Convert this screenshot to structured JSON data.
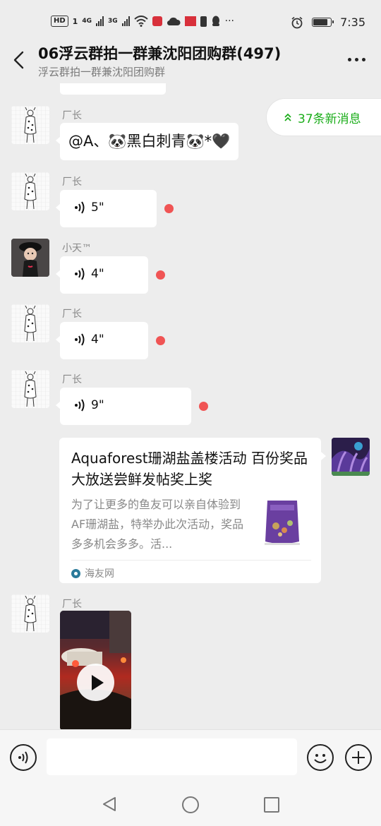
{
  "status_bar": {
    "left_badges": [
      "HD",
      "1",
      "4G",
      "3G"
    ],
    "time": "7:35"
  },
  "header": {
    "title": "06浮云群拍一群兼沈阳团购群(497)",
    "subtitle": "浮云群拍一群兼沈阳团购群"
  },
  "new_messages": {
    "label": "37条新消息"
  },
  "messages": [
    {
      "sender": "厂长",
      "type": "text",
      "text": "@A、🐼黑白刺青🐼*🖤"
    },
    {
      "sender": "厂长",
      "type": "voice",
      "duration": "5\""
    },
    {
      "sender": "小天™",
      "type": "voice",
      "duration": "4\""
    },
    {
      "sender": "厂长",
      "type": "voice",
      "duration": "4\""
    },
    {
      "sender": "厂长",
      "type": "voice",
      "duration": "9\""
    }
  ],
  "link_card": {
    "title": "Aquaforest珊湖盐盖楼活动 百份奖品大放送尝鲜发帖奖上奖",
    "description": "为了让更多的鱼友可以亲自体验到AF珊湖盐，特举办此次活动，奖品多多机会多多。活...",
    "source": "海友网"
  },
  "video_message": {
    "sender": "厂长"
  },
  "colors": {
    "accent_green": "#1aad19",
    "unread_dot": "#f05454",
    "chat_background": "#ededed"
  },
  "icons": [
    "back-arrow-icon",
    "more-icon",
    "double-chevron-up-icon",
    "voice-wave-icon",
    "play-icon",
    "voice-mode-icon",
    "emoji-icon",
    "plus-icon",
    "nav-back-icon",
    "nav-home-icon",
    "nav-recent-icon"
  ]
}
